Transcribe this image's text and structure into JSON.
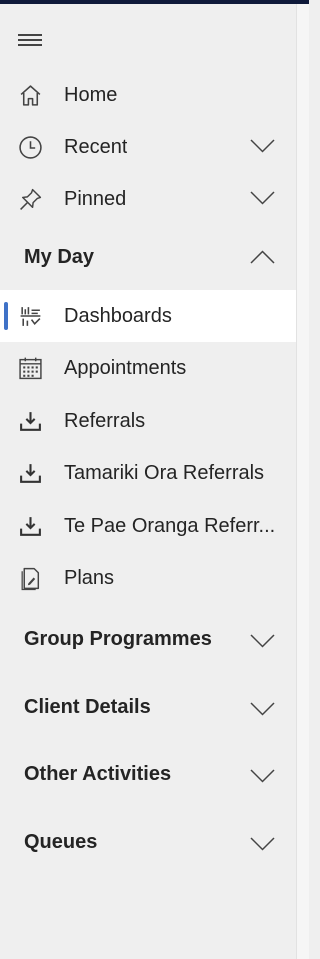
{
  "nav": {
    "items_top": [
      {
        "label": "Home",
        "icon": "home-icon"
      },
      {
        "label": "Recent",
        "icon": "clock-icon",
        "expand": "chevron-down-icon"
      },
      {
        "label": "Pinned",
        "icon": "pin-icon",
        "expand": "chevron-down-icon"
      }
    ],
    "my_day": {
      "label": "My Day",
      "expand": "chevron-up-icon",
      "items": [
        {
          "label": "Dashboards",
          "icon": "dashboard-icon",
          "selected": true
        },
        {
          "label": "Appointments",
          "icon": "calendar-icon"
        },
        {
          "label": "Referrals",
          "icon": "download-tray-icon"
        },
        {
          "label": "Tamariki Ora Referrals",
          "icon": "download-tray-icon"
        },
        {
          "label": "Te Pae Oranga Referr...",
          "icon": "download-tray-icon"
        },
        {
          "label": "Plans",
          "icon": "document-icon"
        }
      ]
    },
    "sections": [
      {
        "label": "Group Programmes",
        "expand": "chevron-down-icon"
      },
      {
        "label": "Client Details",
        "expand": "chevron-down-icon"
      },
      {
        "label": "Other Activities",
        "expand": "chevron-down-icon"
      },
      {
        "label": "Queues",
        "expand": "chevron-down-icon"
      }
    ]
  },
  "colors": {
    "accent": "#3f72c7",
    "top_bar": "#0f1a3a",
    "nav_background": "#efefef",
    "selected_background": "#ffffff"
  }
}
